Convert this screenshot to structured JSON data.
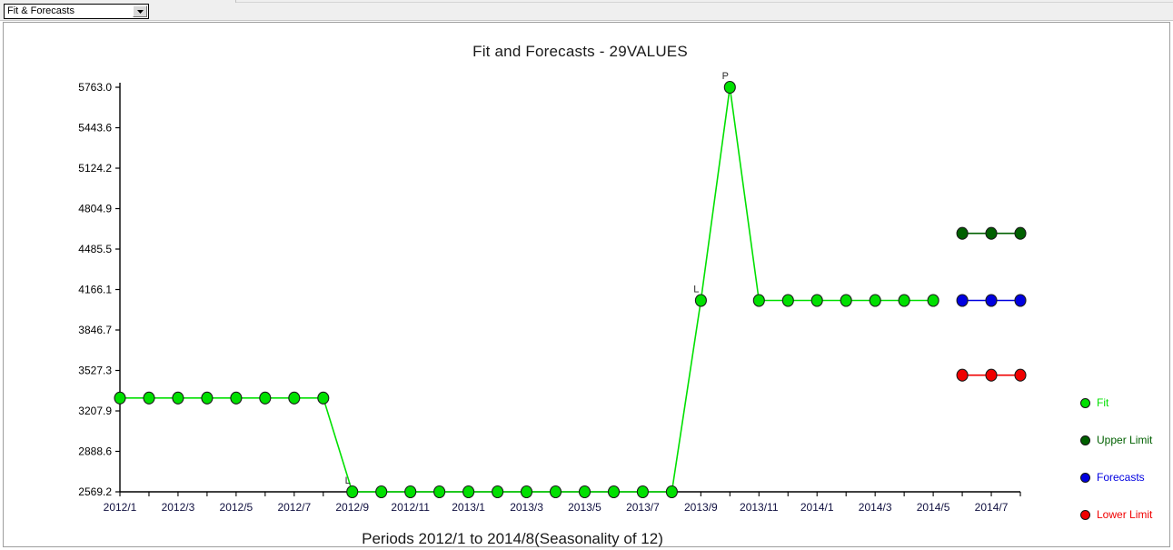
{
  "toolbar": {
    "view_select": {
      "value": "Fit & Forecasts",
      "icon": "chevron-down-icon"
    }
  },
  "chart": {
    "title": "Fit and Forecasts - 29VALUES",
    "xaxis_caption": "Periods 2012/1 to 2014/8(Seasonality of 12)"
  },
  "legend": {
    "items": [
      {
        "label": "Fit",
        "color": "#00e000"
      },
      {
        "label": "Upper Limit",
        "color": "#006000"
      },
      {
        "label": "Forecasts",
        "color": "#0000e0"
      },
      {
        "label": "Lower Limit",
        "color": "#f00000"
      }
    ]
  },
  "chart_data": {
    "type": "line",
    "title": "Fit and Forecasts - 29VALUES",
    "xlabel": "Periods 2012/1 to 2014/8(Seasonality of 12)",
    "ylabel": "",
    "ylim": [
      2569.2,
      5763.0
    ],
    "grid": false,
    "legend_position": "right",
    "ytick_labels": [
      "5763.0",
      "5443.6",
      "5124.2",
      "4804.9",
      "4485.5",
      "4166.1",
      "3846.7",
      "3527.3",
      "3207.9",
      "2888.6",
      "2569.2"
    ],
    "ytick_values": [
      5763.0,
      5443.6,
      5124.2,
      4804.9,
      4485.5,
      4166.1,
      3846.7,
      3527.3,
      3207.9,
      2888.6,
      2569.2
    ],
    "x": [
      "2012/1",
      "2012/2",
      "2012/3",
      "2012/4",
      "2012/5",
      "2012/6",
      "2012/7",
      "2012/8",
      "2012/9",
      "2012/10",
      "2012/11",
      "2012/12",
      "2013/1",
      "2013/2",
      "2013/3",
      "2013/4",
      "2013/5",
      "2013/6",
      "2013/7",
      "2013/8",
      "2013/9",
      "2013/10",
      "2013/11",
      "2013/12",
      "2014/1",
      "2014/2",
      "2014/3",
      "2014/4",
      "2014/5",
      "2014/6",
      "2014/7",
      "2014/8"
    ],
    "xtick_labels": [
      "2012/1",
      "2012/3",
      "2012/5",
      "2012/7",
      "2012/9",
      "2012/11",
      "2013/1",
      "2013/3",
      "2013/5",
      "2013/7",
      "2013/9",
      "2013/11",
      "2014/1",
      "2014/3",
      "2014/5",
      "2014/7"
    ],
    "annotations": [
      {
        "text": "L",
        "x": "2012/9",
        "y": 2569.2
      },
      {
        "text": "L",
        "x": "2013/9",
        "y": 4080.0
      },
      {
        "text": "P",
        "x": "2013/10",
        "y": 5763.0
      }
    ],
    "series": [
      {
        "name": "Fit",
        "color": "#00e000",
        "marker": "circle",
        "x": [
          "2012/1",
          "2012/2",
          "2012/3",
          "2012/4",
          "2012/5",
          "2012/6",
          "2012/7",
          "2012/8",
          "2012/9",
          "2012/10",
          "2012/11",
          "2012/12",
          "2013/1",
          "2013/2",
          "2013/3",
          "2013/4",
          "2013/5",
          "2013/6",
          "2013/7",
          "2013/8",
          "2013/9",
          "2013/10",
          "2013/11",
          "2013/12",
          "2014/1",
          "2014/2",
          "2014/3",
          "2014/4",
          "2014/5"
        ],
        "values": [
          3310,
          3310,
          3310,
          3310,
          3310,
          3310,
          3310,
          3310,
          2569.2,
          2569.2,
          2569.2,
          2569.2,
          2569.2,
          2569.2,
          2569.2,
          2569.2,
          2569.2,
          2569.2,
          2569.2,
          2569.2,
          4080,
          5763.0,
          4080,
          4080,
          4080,
          4080,
          4080,
          4080,
          4080
        ]
      },
      {
        "name": "Upper Limit",
        "color": "#006000",
        "marker": "circle",
        "x": [
          "2014/6",
          "2014/7",
          "2014/8"
        ],
        "values": [
          4610,
          4610,
          4610
        ]
      },
      {
        "name": "Forecasts",
        "color": "#0000e0",
        "marker": "circle",
        "x": [
          "2014/6",
          "2014/7",
          "2014/8"
        ],
        "values": [
          4080,
          4080,
          4080
        ]
      },
      {
        "name": "Lower Limit",
        "color": "#f00000",
        "marker": "circle",
        "x": [
          "2014/6",
          "2014/7",
          "2014/8"
        ],
        "values": [
          3490,
          3490,
          3490
        ]
      }
    ]
  }
}
